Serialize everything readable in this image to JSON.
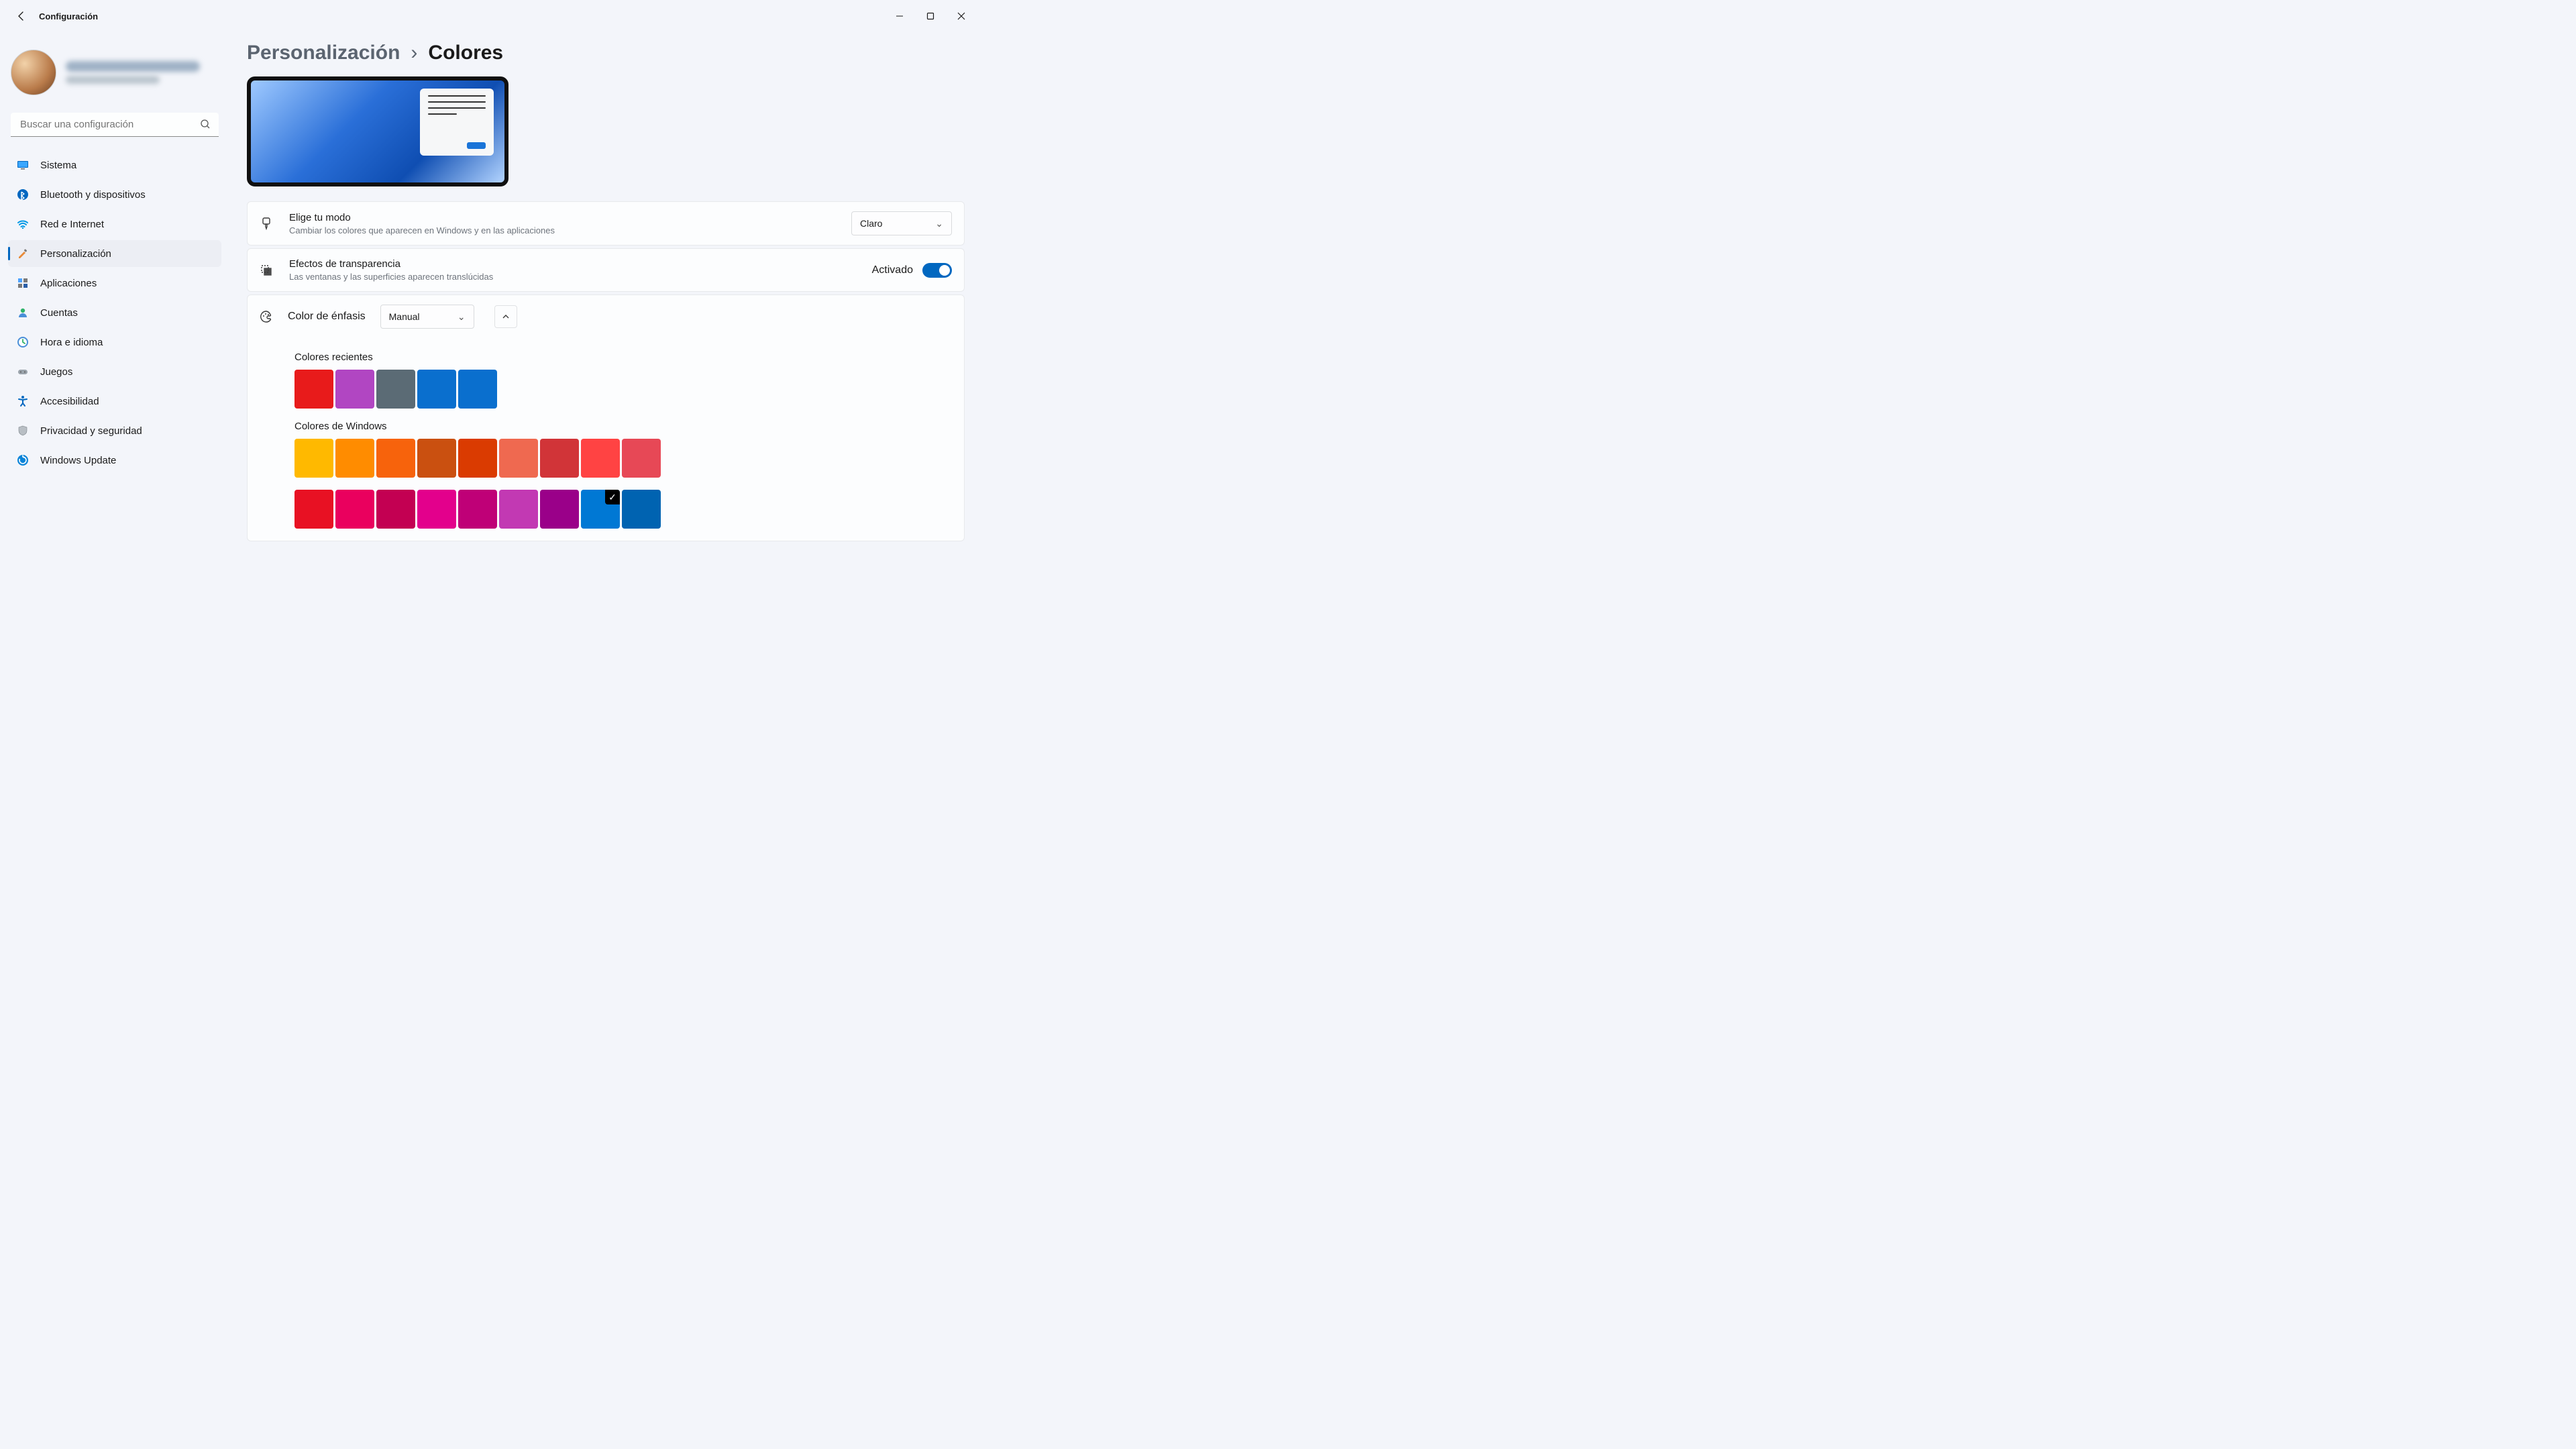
{
  "window": {
    "title": "Configuración"
  },
  "search": {
    "placeholder": "Buscar una configuración"
  },
  "nav": [
    {
      "label": "Sistema",
      "icon": "system"
    },
    {
      "label": "Bluetooth y dispositivos",
      "icon": "bluetooth"
    },
    {
      "label": "Red e Internet",
      "icon": "wifi"
    },
    {
      "label": "Personalización",
      "icon": "personalize",
      "active": true
    },
    {
      "label": "Aplicaciones",
      "icon": "apps"
    },
    {
      "label": "Cuentas",
      "icon": "accounts"
    },
    {
      "label": "Hora e idioma",
      "icon": "time"
    },
    {
      "label": "Juegos",
      "icon": "gaming"
    },
    {
      "label": "Accesibilidad",
      "icon": "accessibility"
    },
    {
      "label": "Privacidad y seguridad",
      "icon": "privacy"
    },
    {
      "label": "Windows Update",
      "icon": "update"
    }
  ],
  "breadcrumb": {
    "parent": "Personalización",
    "current": "Colores"
  },
  "settings": {
    "mode": {
      "title": "Elige tu modo",
      "subtitle": "Cambiar los colores que aparecen en Windows y en las aplicaciones",
      "value": "Claro"
    },
    "transparency": {
      "title": "Efectos de transparencia",
      "subtitle": "Las ventanas y las superficies aparecen translúcidas",
      "state_label": "Activado",
      "on": true
    },
    "accent": {
      "title": "Color de énfasis",
      "value": "Manual",
      "recent_label": "Colores recientes",
      "recent_colors": [
        "#e81b1b",
        "#b146c2",
        "#5b6b75",
        "#0a6fce",
        "#0a6fce"
      ],
      "windows_label": "Colores de Windows",
      "windows_colors_row1": [
        "#ffb900",
        "#ff8c00",
        "#f7630c",
        "#ca5010",
        "#da3b01",
        "#ef6950",
        "#d13438",
        "#ff4343",
        "#e74856"
      ],
      "windows_colors_row2": [
        "#e81123",
        "#ea005e",
        "#c30052",
        "#e3008c",
        "#bf0077",
        "#c239b3",
        "#9a0089",
        "#0078d4",
        "#0063b1"
      ],
      "selected_index_row2": 7
    }
  }
}
